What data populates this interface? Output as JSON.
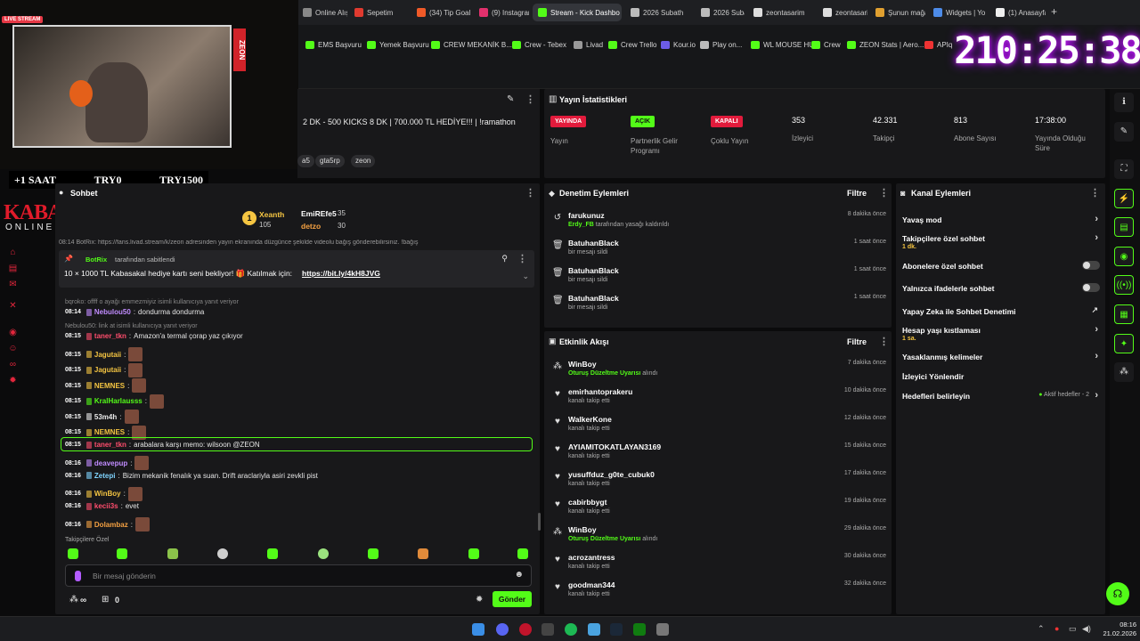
{
  "browser": {
    "tabs": [
      "Online Alışve",
      "Sepetim",
      "(34) Tip Goal",
      "(9) Instagram",
      "Stream - Kick Dashbo",
      "2026 Subath",
      "2026 Subath",
      "zeontasarim",
      "zeontasarim",
      "Şunun mağa",
      "Widgets | Yo",
      "(1) Anasayfa"
    ],
    "bookmarks": [
      "EMS Başvuru",
      "Yemek Başvuru",
      "CREW MEKANİK B...",
      "Crew - Tebex",
      "Livad",
      "Crew Trello",
      "Kour.io",
      "Play on...",
      "WL MOUSE HUB",
      "Crew",
      "ZEON Stats | Aero...",
      "APIq"
    ]
  },
  "overlay": {
    "live_label": "LIVE STREAM",
    "zeon": "ZEON",
    "bar": [
      "+1 SAAT",
      "TRY0",
      "TRY1500"
    ],
    "logo_main": "KABASAKAL",
    "logo_sub": "ONLINE.COM",
    "timer": "210:25:38"
  },
  "stream_info": {
    "title": "2 DK - 500 KICKS 8 DK | 700.000 TL HEDİYE!!! | !ramathon",
    "tags": [
      "a5",
      "gta5rp",
      "zeon"
    ]
  },
  "stats": {
    "header": "Yayın İstatistikleri",
    "items": [
      {
        "badge": "YAYINDA",
        "label": "Yayın",
        "color": "#e21b3c"
      },
      {
        "badge": "AÇIK",
        "label": "Partnerlik Gelir Programı",
        "color": "#53fc18"
      },
      {
        "badge": "KAPALI",
        "label": "Çoklu Yayın",
        "color": "#e21b3c"
      },
      {
        "value": "353",
        "label": "İzleyici"
      },
      {
        "value": "42.331",
        "label": "Takipçi"
      },
      {
        "value": "813",
        "label": "Abone Sayısı"
      },
      {
        "value": "17:38:00",
        "label": "Yayında Olduğu Süre"
      }
    ]
  },
  "chat": {
    "header": "Sohbet",
    "leaders": [
      {
        "rank": "1",
        "name": "Xeanth",
        "amount": "105"
      },
      {
        "name": "EmiREfe5",
        "amount": "35"
      },
      {
        "name": "detzo",
        "amount": "30"
      }
    ],
    "pinned_by": "BotRix",
    "pinned_suffix": "tarafından sabitlendi",
    "pinned_text": "10 × 1000 TL Kabasakal hediye kartı seni bekliyor! 🎁 Katılmak için:",
    "pinned_link": "https://bit.ly/4kH8JVG",
    "top_cut": "08:14  BotRix: https://fans.livad.stream/k/zeon adresinden yayın ekranında düzgünce şekilde videolu bağış gönderebilirsiniz. !bağış",
    "messages": [
      {
        "reply": "bqroko: offff o ayağı emmezmiyiz isimli kullanıcıya yanıt veriyor",
        "ts": "08:14",
        "user": "Nebulou50",
        "color": "#c18cff",
        "text": "dondurma dondurma"
      },
      {
        "reply": "Nebulou50: link at isimli kullanıcıya yanıt veriyor",
        "ts": "08:15",
        "user": "taner_tkn",
        "color": "#ff4d6d",
        "text": "Amazon'a termal çorap yaz çıkıyor"
      },
      {
        "ts": "08:15",
        "user": "Jagutaii",
        "color": "#f5c542",
        "text": "",
        "emote": true
      },
      {
        "ts": "08:15",
        "user": "Jagutaii",
        "color": "#f5c542",
        "text": "",
        "emote": true
      },
      {
        "ts": "08:15",
        "user": "NEMNES",
        "color": "#f5c542",
        "text": "",
        "emote": true
      },
      {
        "ts": "08:15",
        "user": "KralHarlausss",
        "color": "#53fc18",
        "text": "",
        "emote": true
      },
      {
        "ts": "08:15",
        "user": "53m4h",
        "color": "#eaeaea",
        "text": "",
        "emote": true
      },
      {
        "ts": "08:15",
        "user": "NEMNES",
        "color": "#f5c542",
        "text": "",
        "emote": true
      },
      {
        "ts": "08:15",
        "user": "taner_tkn",
        "color": "#ff4d6d",
        "text": "arabalara karşı memo: wilsoon @ZEON",
        "highlight": true
      },
      {
        "ts": "08:16",
        "user": "deavepup",
        "color": "#c18cff",
        "text": "",
        "emote": true
      },
      {
        "ts": "08:16",
        "user": "Zetepi",
        "color": "#7fd4ff",
        "text": "Bizim mekanik fenalık ya suan. Drift araclariyla asiri zevkli pist"
      },
      {
        "ts": "08:16",
        "user": "WinBoy",
        "color": "#f5c542",
        "text": "",
        "emote": true
      },
      {
        "ts": "08:16",
        "user": "kecii3s",
        "color": "#ff4d6d",
        "text": "evet"
      },
      {
        "ts": "08:16",
        "user": "Dolambaz",
        "color": "#f5a142",
        "text": "",
        "emote": true
      }
    ],
    "followers_only": "Takipçilere Özel",
    "input_placeholder": "Bir mesaj gönderin",
    "send_label": "Gönder",
    "points": "∞",
    "gift_count": "0"
  },
  "moderation": {
    "header": "Denetim Eylemleri",
    "filter": "Filtre",
    "rows": [
      {
        "name": "farukunuz",
        "actor": "Erdy_FB",
        "sub": "tarafından yasağı kaldırıldı",
        "time": "8 dakika önce",
        "icon": "unban"
      },
      {
        "name": "BatuhanBlack",
        "sub": "bir mesajı sildi",
        "time": "1 saat önce",
        "icon": "trash"
      },
      {
        "name": "BatuhanBlack",
        "sub": "bir mesajı sildi",
        "time": "1 saat önce",
        "icon": "trash"
      },
      {
        "name": "BatuhanBlack",
        "sub": "bir mesajı sildi",
        "time": "1 saat önce",
        "icon": "trash"
      }
    ]
  },
  "activity": {
    "header": "Etkinlik Akışı",
    "filter": "Filtre",
    "rows": [
      {
        "name": "WinBoy",
        "accent": "Oturuş Düzeltme Uyarısı",
        "sub": "alındı",
        "time": "7 dakika önce",
        "icon": "reward"
      },
      {
        "name": "emirhantoprakeru",
        "sub": "kanalı takip etti",
        "time": "10 dakika önce",
        "icon": "heart"
      },
      {
        "name": "WalkerKone",
        "sub": "kanalı takip etti",
        "time": "12 dakika önce",
        "icon": "heart"
      },
      {
        "name": "AYIAMITOKATLAYAN3169",
        "sub": "kanalı takip etti",
        "time": "15 dakika önce",
        "icon": "heart"
      },
      {
        "name": "yusuffduz_g0te_cubuk0",
        "sub": "kanalı takip etti",
        "time": "17 dakika önce",
        "icon": "heart"
      },
      {
        "name": "cabirbbygt",
        "sub": "kanalı takip etti",
        "time": "19 dakika önce",
        "icon": "heart"
      },
      {
        "name": "WinBoy",
        "accent": "Oturuş Düzeltme Uyarısı",
        "sub": "alındı",
        "time": "29 dakika önce",
        "icon": "reward"
      },
      {
        "name": "acrozantress",
        "sub": "kanalı takip etti",
        "time": "30 dakika önce",
        "icon": "heart"
      },
      {
        "name": "goodman344",
        "sub": "kanalı takip etti",
        "time": "32 dakika önce",
        "icon": "heart"
      }
    ]
  },
  "channel": {
    "header": "Kanal Eylemleri",
    "rows": [
      {
        "label": "Yavaş mod",
        "kind": "chevron"
      },
      {
        "label": "Takipçilere özel sohbet",
        "sub": "1 dk.",
        "kind": "chevron"
      },
      {
        "label": "Abonelere özel sohbet",
        "kind": "toggle"
      },
      {
        "label": "Yalnızca ifadelerle sohbet",
        "kind": "toggle"
      },
      {
        "label": "Yapay Zeka ile Sohbet Denetimi",
        "kind": "external"
      },
      {
        "label": "Hesap yaşı kıstlaması",
        "sub": "1 sa.",
        "kind": "chevron"
      },
      {
        "label": "Yasaklanmış kelimeler",
        "kind": "chevron"
      },
      {
        "label": "İzleyici Yönlendir",
        "kind": "none"
      },
      {
        "label": "Hedefleri belirleyin",
        "extra": "Aktif hedefler - 2",
        "kind": "chevron"
      }
    ]
  },
  "taskbar": {
    "time": "08:16",
    "date": "21.02.2026"
  },
  "colors": {
    "kick_green": "#53fc18",
    "red": "#e21b3c"
  }
}
